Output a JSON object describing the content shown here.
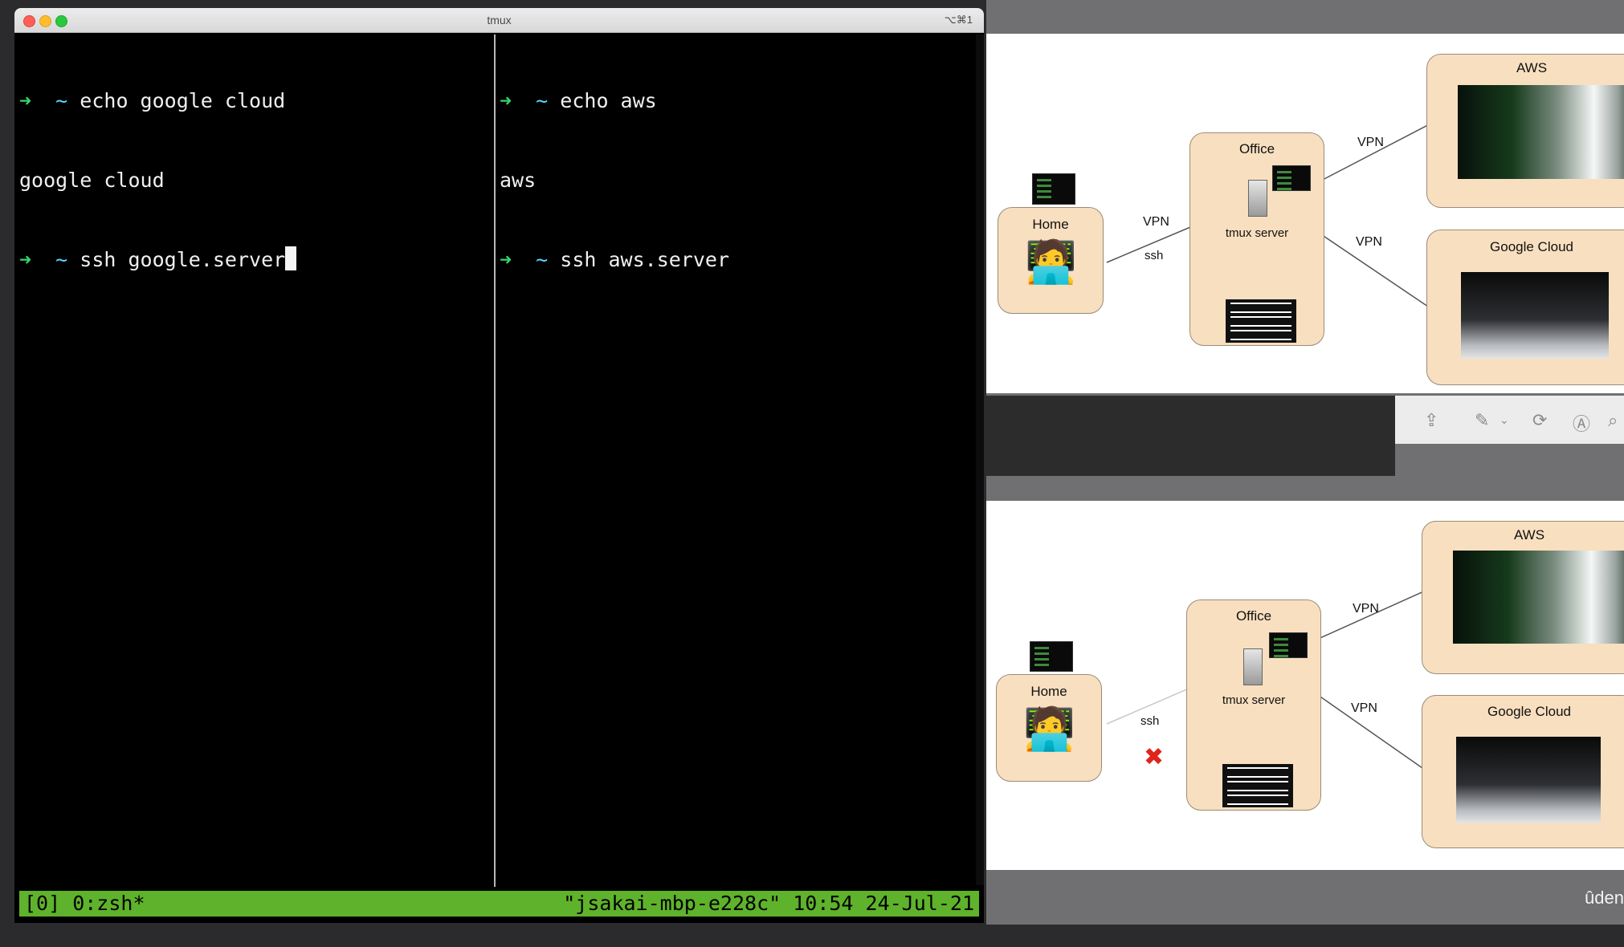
{
  "terminal": {
    "title": "tmux",
    "shortcut": "⌥⌘1",
    "left_pane": {
      "lines": [
        {
          "prompt_arrow": "➜",
          "prompt_tilde": "~",
          "command": "echo google cloud"
        },
        {
          "output": "google cloud"
        },
        {
          "prompt_arrow": "➜",
          "prompt_tilde": "~",
          "command": "ssh google.server"
        }
      ]
    },
    "right_pane": {
      "lines": [
        {
          "prompt_arrow": "➜",
          "prompt_tilde": "~",
          "command": "echo aws"
        },
        {
          "output": "aws"
        },
        {
          "prompt_arrow": "➜",
          "prompt_tilde": "~",
          "command": "ssh aws.server"
        }
      ]
    },
    "status_left": "[0] 0:zsh*",
    "status_right": "\"jsakai-mbp-e228c\" 10:54 24-Jul-21",
    "status_color": "#5fb22b"
  },
  "diagram_top": {
    "home": "Home",
    "office": "Office",
    "tmux_server": "tmux server",
    "aws": "AWS",
    "google_cloud": "Google Cloud",
    "vpn_home": "VPN",
    "ssh": "ssh",
    "vpn_aws": "VPN",
    "vpn_gcloud": "VPN"
  },
  "diagram_bottom": {
    "home": "Home",
    "office": "Office",
    "tmux_server": "tmux server",
    "aws": "AWS",
    "google_cloud": "Google Cloud",
    "ssh": "ssh",
    "vpn_aws": "VPN",
    "vpn_gcloud": "VPN",
    "broken_mark": "✖"
  },
  "viewer": {
    "toolbar_icons": [
      "share-icon",
      "pen-icon",
      "rotate-icon",
      "markup-icon",
      "search-icon"
    ],
    "watermark": "ûden"
  }
}
